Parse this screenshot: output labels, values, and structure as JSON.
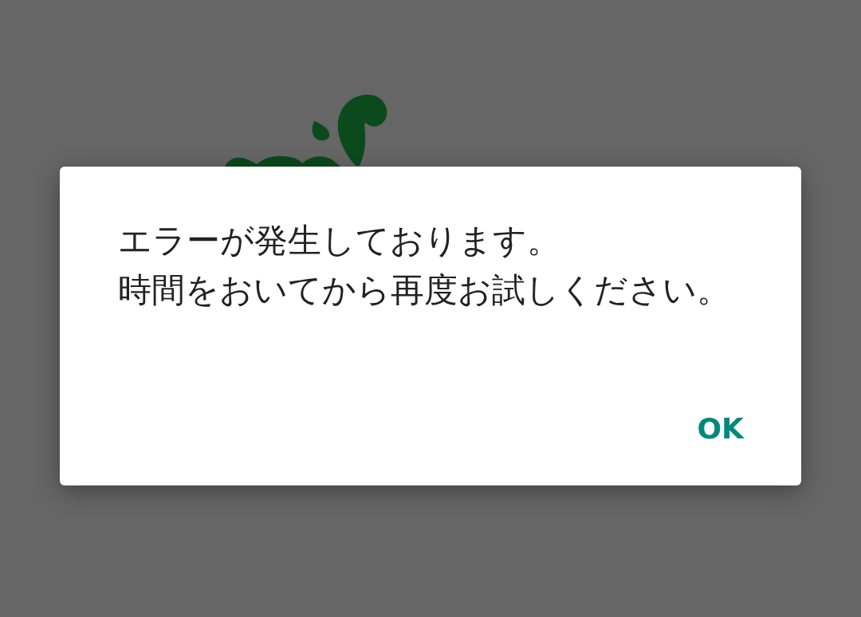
{
  "dialog": {
    "message_lines": [
      "エラーが発生しております。",
      "時間をおいてから再度お試しください。"
    ],
    "buttons": [
      {
        "label": "OK"
      }
    ]
  }
}
